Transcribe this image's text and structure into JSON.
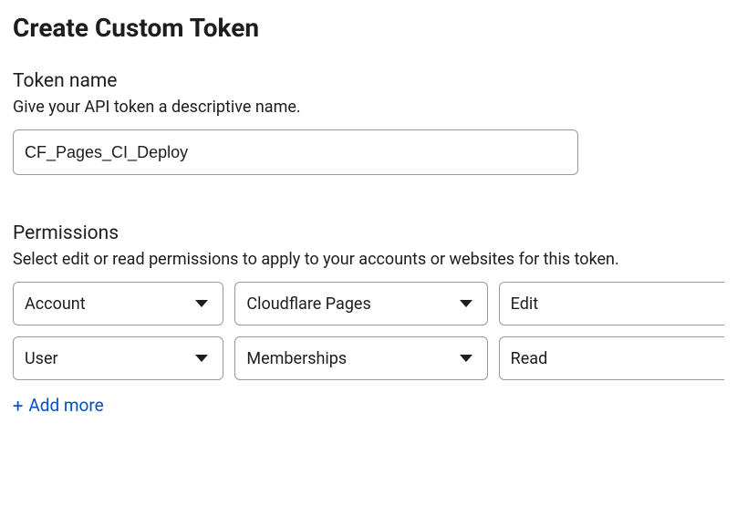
{
  "header": {
    "title": "Create Custom Token"
  },
  "tokenName": {
    "label": "Token name",
    "description": "Give your API token a descriptive name.",
    "value": "CF_Pages_CI_Deploy"
  },
  "permissions": {
    "label": "Permissions",
    "description": "Select edit or read permissions to apply to your accounts or websites for this token.",
    "rows": [
      {
        "scope": "Account",
        "resource": "Cloudflare Pages",
        "access": "Edit"
      },
      {
        "scope": "User",
        "resource": "Memberships",
        "access": "Read"
      }
    ],
    "addMoreLabel": "Add more"
  }
}
